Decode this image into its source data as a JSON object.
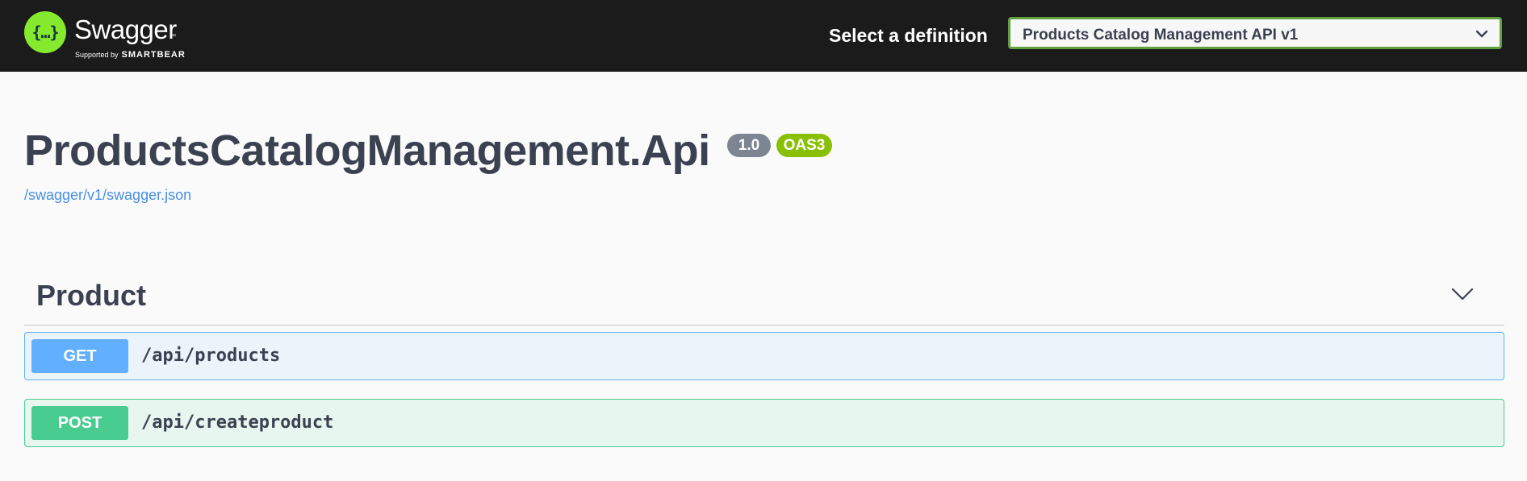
{
  "header": {
    "logo_glyph": "{…}",
    "brand_name": "Swagger",
    "brand_tm": "™",
    "supported_by": "Supported by",
    "smartbear": "SMARTBEAR",
    "select_label": "Select a definition",
    "selected_definition": "Products Catalog Management API v1",
    "chevron_icon": "chevron-down-icon"
  },
  "info": {
    "title": "ProductsCatalogManagement.Api",
    "version_badge": "1.0",
    "oas_badge": "OAS3",
    "spec_link": "/swagger/v1/swagger.json"
  },
  "tag": {
    "name": "Product",
    "chevron_icon": "chevron-down-icon"
  },
  "operations": [
    {
      "method": "GET",
      "path": "/api/products",
      "color": "#61affe"
    },
    {
      "method": "POST",
      "path": "/api/createproduct",
      "color": "#49cc90"
    }
  ],
  "colors": {
    "topbar": "#1b1b1b",
    "logo": "#85ea2d",
    "select_border": "#62a03f",
    "oas_badge": "#89bf04",
    "version_badge": "#7d8492",
    "link": "#4990e2"
  }
}
